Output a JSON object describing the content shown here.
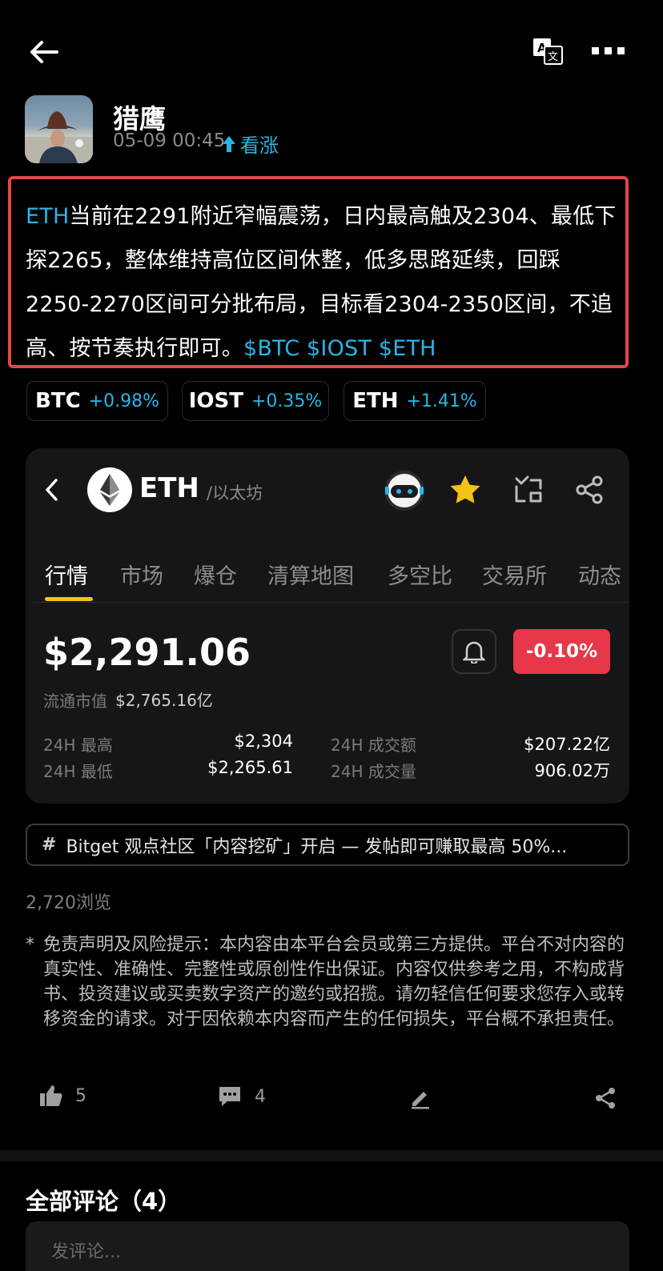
{
  "topbar": {
    "back_icon": "back-arrow-icon",
    "translate_icon": "translate-icon",
    "more_icon": "more-dots-icon"
  },
  "author": {
    "name": "猎鹰",
    "time": "05-09 00:45",
    "sentiment": "看涨",
    "sentiment_color": "#29b5e6"
  },
  "post": {
    "seg_1": "ETH",
    "seg_2": "当前在2291附近窄幅震荡，日内最高触及2304、最低下探2265，整体维持高位区间休整，低多思路延续，回踩2250-2270区间可分批布局，目标看2304-2350区间，不追高、按节奏执行即可。",
    "seg_3": "$BTC $IOST $ETH"
  },
  "tickers": [
    {
      "symbol": "BTC",
      "change": "+0.98%"
    },
    {
      "symbol": "IOST",
      "change": "+0.35%"
    },
    {
      "symbol": "ETH",
      "change": "+1.41%"
    }
  ],
  "card": {
    "coin": "ETH",
    "coin_sub": "/以太坊",
    "tabs": [
      "行情",
      "市场",
      "爆仓",
      "清算地图",
      "多空比",
      "交易所",
      "动态"
    ],
    "price": "$2,291.06",
    "change": "-0.10%",
    "change_color": "#e8364a",
    "market_cap_label": "流通市值",
    "market_cap_value": "$2,765.16亿",
    "high_label": "24H 最高",
    "high_value": "$2,304",
    "low_label": "24H 最低",
    "low_value": "$2,265.61",
    "turnover_label": "24H 成交额",
    "turnover_value": "$207.22亿",
    "volume_label": "24H 成交量",
    "volume_value": "906.02万"
  },
  "banner": {
    "hash": "#",
    "text": "Bitget 观点社区「内容挖矿」开启 — 发帖即可赚取最高 50%..."
  },
  "views": "2,720浏览",
  "disclaimer": {
    "star": "*",
    "text": "免责声明及风险提示：本内容由本平台会员或第三方提供。平台不对内容的真实性、准确性、完整性或原创性作出保证。内容仅供参考之用，不构成背书、投资建议或买卖数字资产的邀约或招揽。请勿轻信任何要求您存入或转移资金的请求。对于因依赖本内容而产生的任何损失，平台概不承担责任。"
  },
  "actions": {
    "likes": "5",
    "comments": "4"
  },
  "comments": {
    "title": "全部评论（4）",
    "placeholder": "发评论..."
  }
}
